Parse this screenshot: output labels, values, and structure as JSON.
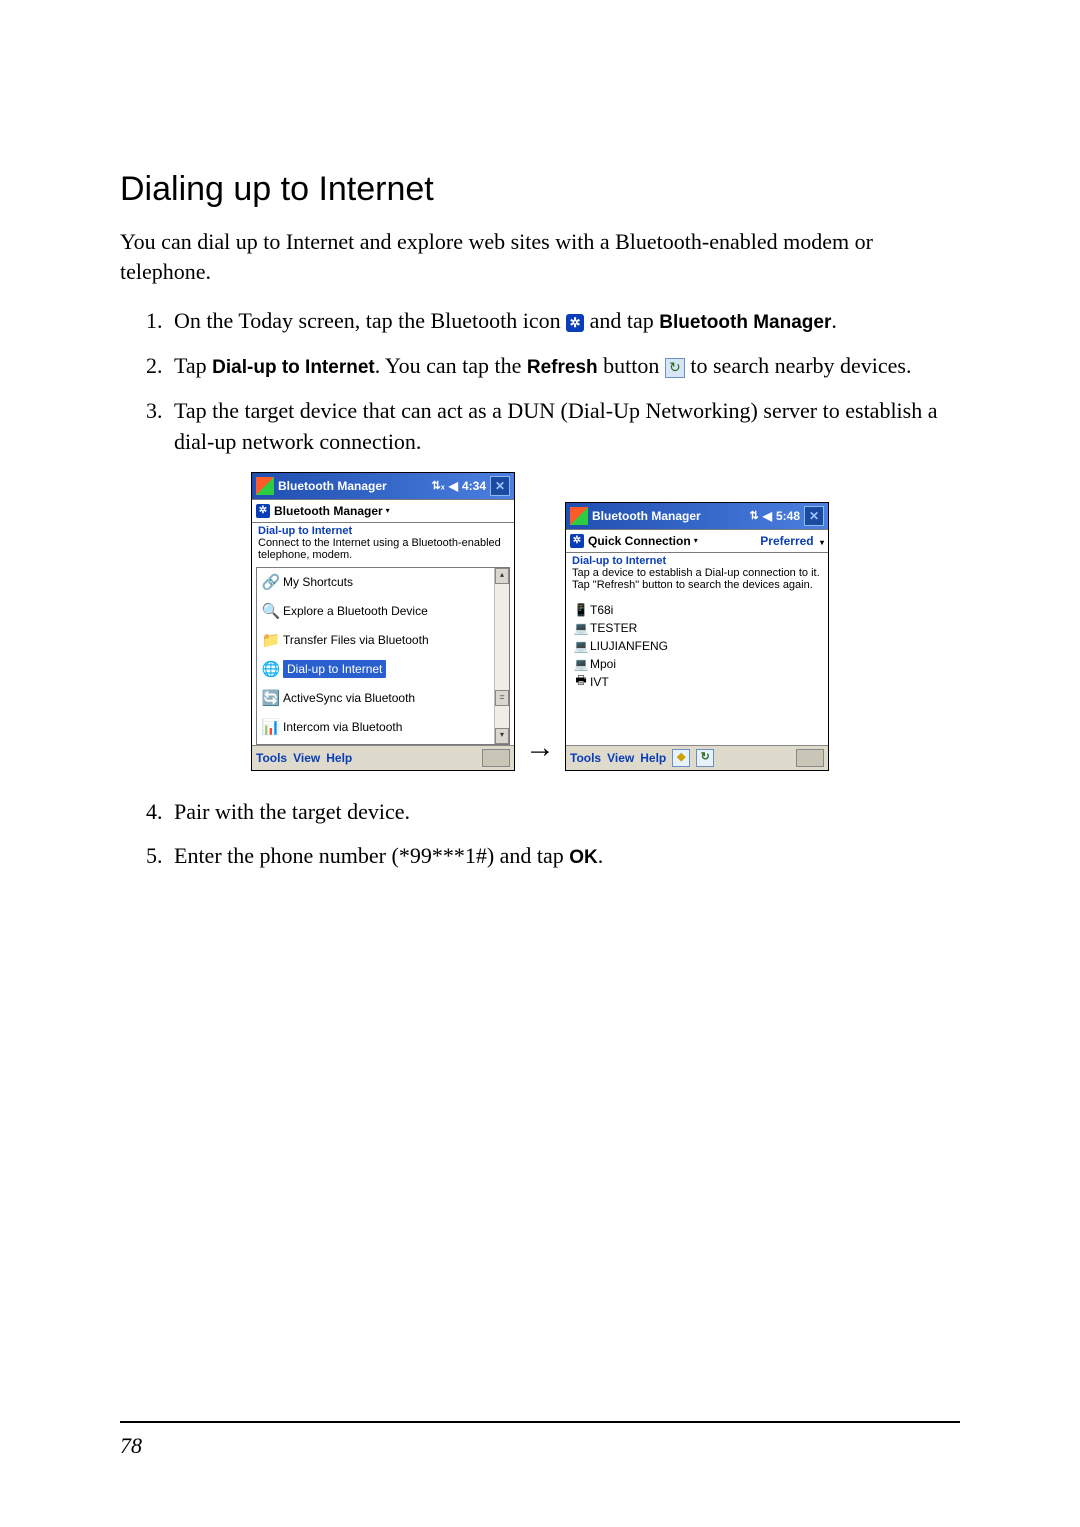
{
  "heading": "Dialing up to Internet",
  "intro": "You can dial up to Internet and explore web sites with a Bluetooth-enabled modem or telephone.",
  "steps": {
    "s1_a": "On the Today screen, tap the Bluetooth icon ",
    "s1_b": " and tap ",
    "s1_btmgr": "Bluetooth Manager",
    "s1_end": ".",
    "s2_a": "Tap ",
    "s2_dial": "Dial-up to Internet",
    "s2_b": ". You can tap the ",
    "s2_refresh": "Refresh",
    "s2_c": " button ",
    "s2_d": " to search nearby devices.",
    "s3": "Tap the target device that can act as a DUN (Dial-Up Networking) server to establish a dial-up network connection.",
    "s4": "Pair with the target device.",
    "s5_a": "Enter the phone number (*99***1#) and tap ",
    "s5_ok": "OK",
    "s5_end": "."
  },
  "screens": {
    "left": {
      "title": "Bluetooth Manager",
      "time": "4:34",
      "toolbar_label": "Bluetooth Manager",
      "desc_head": "Dial-up to Internet",
      "desc_body": "Connect to the Internet using a Bluetooth-enabled telephone, modem.",
      "items": [
        {
          "icon": "🔗",
          "label": "My Shortcuts"
        },
        {
          "icon": "🔍",
          "label": "Explore a Bluetooth Device"
        },
        {
          "icon": "📁",
          "label": "Transfer Files via Bluetooth"
        },
        {
          "icon": "🌐",
          "label": "Dial-up to Internet",
          "selected": true
        },
        {
          "icon": "🔄",
          "label": "ActiveSync via Bluetooth"
        },
        {
          "icon": "📊",
          "label": "Intercom via Bluetooth"
        }
      ],
      "bottom": [
        "Tools",
        "View",
        "Help"
      ]
    },
    "right": {
      "title": "Bluetooth Manager",
      "time": "5:48",
      "toolbar_label": "Quick Connection",
      "preferred": "Preferred",
      "desc_head": "Dial-up to Internet",
      "desc_body": "Tap a device to establish a Dial-up connection to it. Tap \"Refresh\" button to search the devices again.",
      "devices": [
        {
          "icon": "📱",
          "label": "T68i"
        },
        {
          "icon": "💻",
          "label": "TESTER"
        },
        {
          "icon": "💻",
          "label": "LIUJIANFENG"
        },
        {
          "icon": "💻",
          "label": "Mpoi"
        },
        {
          "icon": "🖶",
          "label": "IVT"
        }
      ],
      "bottom": [
        "Tools",
        "View",
        "Help"
      ]
    }
  },
  "icons": {
    "bt_glyph": "✲",
    "refresh_glyph": "↻",
    "close_glyph": "✕",
    "speaker": "◀",
    "tri": "▾",
    "up": "▴",
    "down": "▾",
    "thumb": "="
  },
  "page_number": "78",
  "arrow": "→"
}
